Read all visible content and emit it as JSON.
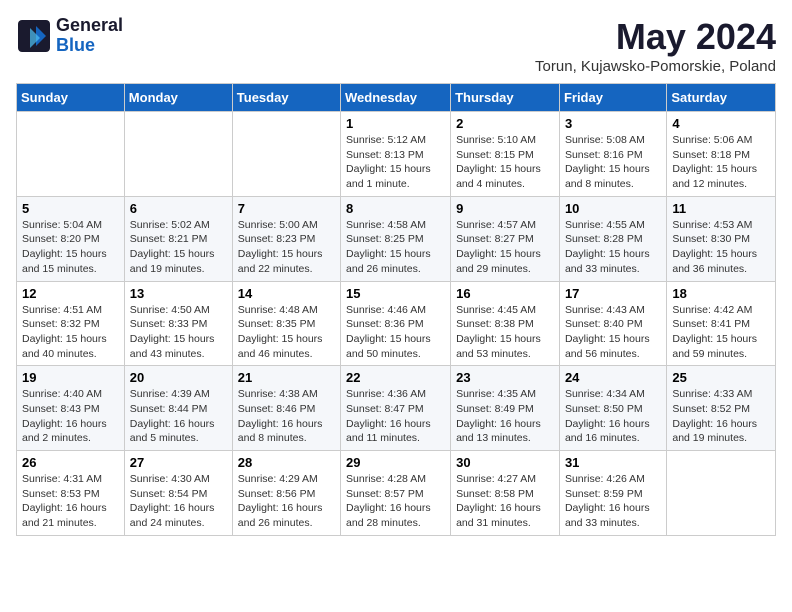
{
  "logo": {
    "general": "General",
    "blue": "Blue"
  },
  "title": {
    "month": "May 2024",
    "location": "Torun, Kujawsko-Pomorskie, Poland"
  },
  "weekdays": [
    "Sunday",
    "Monday",
    "Tuesday",
    "Wednesday",
    "Thursday",
    "Friday",
    "Saturday"
  ],
  "weeks": [
    [
      {
        "day": "",
        "info": ""
      },
      {
        "day": "",
        "info": ""
      },
      {
        "day": "",
        "info": ""
      },
      {
        "day": "1",
        "info": "Sunrise: 5:12 AM\nSunset: 8:13 PM\nDaylight: 15 hours and 1 minute."
      },
      {
        "day": "2",
        "info": "Sunrise: 5:10 AM\nSunset: 8:15 PM\nDaylight: 15 hours and 4 minutes."
      },
      {
        "day": "3",
        "info": "Sunrise: 5:08 AM\nSunset: 8:16 PM\nDaylight: 15 hours and 8 minutes."
      },
      {
        "day": "4",
        "info": "Sunrise: 5:06 AM\nSunset: 8:18 PM\nDaylight: 15 hours and 12 minutes."
      }
    ],
    [
      {
        "day": "5",
        "info": "Sunrise: 5:04 AM\nSunset: 8:20 PM\nDaylight: 15 hours and 15 minutes."
      },
      {
        "day": "6",
        "info": "Sunrise: 5:02 AM\nSunset: 8:21 PM\nDaylight: 15 hours and 19 minutes."
      },
      {
        "day": "7",
        "info": "Sunrise: 5:00 AM\nSunset: 8:23 PM\nDaylight: 15 hours and 22 minutes."
      },
      {
        "day": "8",
        "info": "Sunrise: 4:58 AM\nSunset: 8:25 PM\nDaylight: 15 hours and 26 minutes."
      },
      {
        "day": "9",
        "info": "Sunrise: 4:57 AM\nSunset: 8:27 PM\nDaylight: 15 hours and 29 minutes."
      },
      {
        "day": "10",
        "info": "Sunrise: 4:55 AM\nSunset: 8:28 PM\nDaylight: 15 hours and 33 minutes."
      },
      {
        "day": "11",
        "info": "Sunrise: 4:53 AM\nSunset: 8:30 PM\nDaylight: 15 hours and 36 minutes."
      }
    ],
    [
      {
        "day": "12",
        "info": "Sunrise: 4:51 AM\nSunset: 8:32 PM\nDaylight: 15 hours and 40 minutes."
      },
      {
        "day": "13",
        "info": "Sunrise: 4:50 AM\nSunset: 8:33 PM\nDaylight: 15 hours and 43 minutes."
      },
      {
        "day": "14",
        "info": "Sunrise: 4:48 AM\nSunset: 8:35 PM\nDaylight: 15 hours and 46 minutes."
      },
      {
        "day": "15",
        "info": "Sunrise: 4:46 AM\nSunset: 8:36 PM\nDaylight: 15 hours and 50 minutes."
      },
      {
        "day": "16",
        "info": "Sunrise: 4:45 AM\nSunset: 8:38 PM\nDaylight: 15 hours and 53 minutes."
      },
      {
        "day": "17",
        "info": "Sunrise: 4:43 AM\nSunset: 8:40 PM\nDaylight: 15 hours and 56 minutes."
      },
      {
        "day": "18",
        "info": "Sunrise: 4:42 AM\nSunset: 8:41 PM\nDaylight: 15 hours and 59 minutes."
      }
    ],
    [
      {
        "day": "19",
        "info": "Sunrise: 4:40 AM\nSunset: 8:43 PM\nDaylight: 16 hours and 2 minutes."
      },
      {
        "day": "20",
        "info": "Sunrise: 4:39 AM\nSunset: 8:44 PM\nDaylight: 16 hours and 5 minutes."
      },
      {
        "day": "21",
        "info": "Sunrise: 4:38 AM\nSunset: 8:46 PM\nDaylight: 16 hours and 8 minutes."
      },
      {
        "day": "22",
        "info": "Sunrise: 4:36 AM\nSunset: 8:47 PM\nDaylight: 16 hours and 11 minutes."
      },
      {
        "day": "23",
        "info": "Sunrise: 4:35 AM\nSunset: 8:49 PM\nDaylight: 16 hours and 13 minutes."
      },
      {
        "day": "24",
        "info": "Sunrise: 4:34 AM\nSunset: 8:50 PM\nDaylight: 16 hours and 16 minutes."
      },
      {
        "day": "25",
        "info": "Sunrise: 4:33 AM\nSunset: 8:52 PM\nDaylight: 16 hours and 19 minutes."
      }
    ],
    [
      {
        "day": "26",
        "info": "Sunrise: 4:31 AM\nSunset: 8:53 PM\nDaylight: 16 hours and 21 minutes."
      },
      {
        "day": "27",
        "info": "Sunrise: 4:30 AM\nSunset: 8:54 PM\nDaylight: 16 hours and 24 minutes."
      },
      {
        "day": "28",
        "info": "Sunrise: 4:29 AM\nSunset: 8:56 PM\nDaylight: 16 hours and 26 minutes."
      },
      {
        "day": "29",
        "info": "Sunrise: 4:28 AM\nSunset: 8:57 PM\nDaylight: 16 hours and 28 minutes."
      },
      {
        "day": "30",
        "info": "Sunrise: 4:27 AM\nSunset: 8:58 PM\nDaylight: 16 hours and 31 minutes."
      },
      {
        "day": "31",
        "info": "Sunrise: 4:26 AM\nSunset: 8:59 PM\nDaylight: 16 hours and 33 minutes."
      },
      {
        "day": "",
        "info": ""
      }
    ]
  ]
}
